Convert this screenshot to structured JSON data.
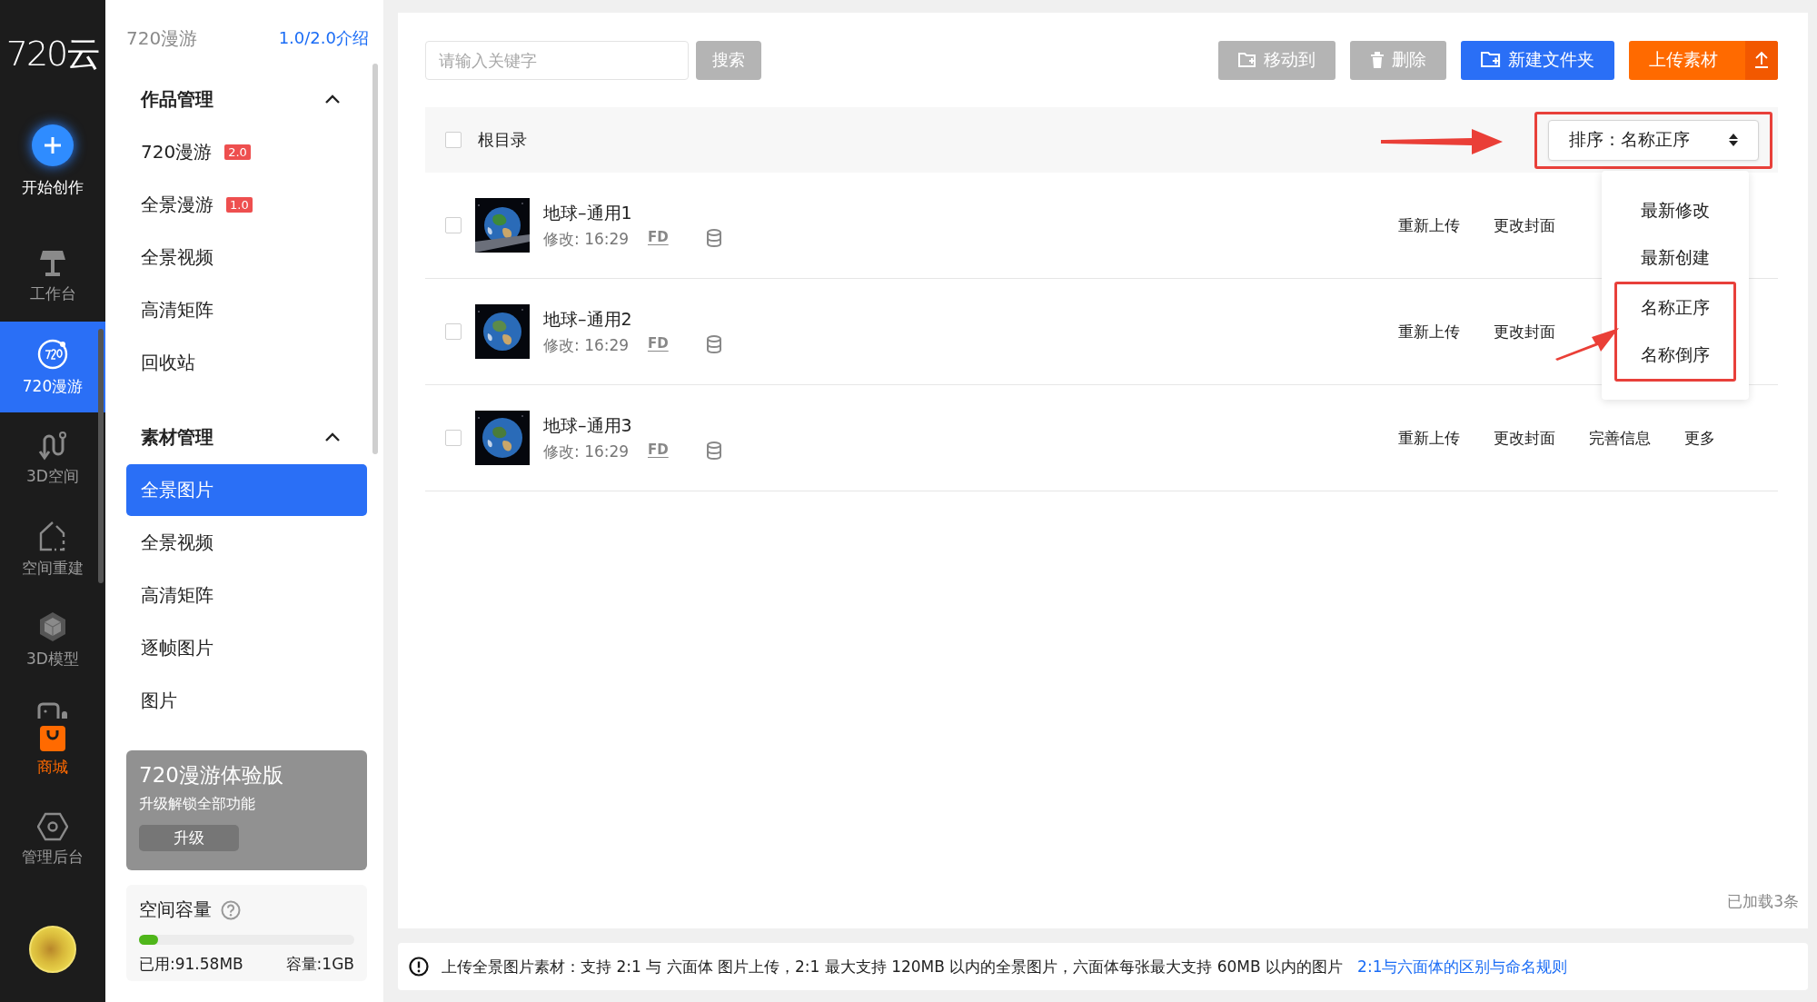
{
  "nav": {
    "logo": "720云",
    "create": {
      "label": "开始创作"
    },
    "items": [
      {
        "kind": "workbench",
        "label": "工作台",
        "selected": false,
        "accent": false
      },
      {
        "kind": "tour",
        "label": "720漫游",
        "selected": true,
        "accent": false
      },
      {
        "kind": "space3d",
        "label": "3D空间",
        "selected": false,
        "accent": false
      },
      {
        "kind": "rebuild",
        "label": "空间重建",
        "selected": false,
        "accent": false
      },
      {
        "kind": "model",
        "label": "3D模型",
        "selected": false,
        "accent": false
      },
      {
        "kind": "shop",
        "label": "商城",
        "selected": false,
        "accent": true
      },
      {
        "kind": "admin",
        "label": "管理后台",
        "selected": false,
        "accent": false
      }
    ]
  },
  "sidebar": {
    "title": "720漫游",
    "intro_link": "1.0/2.0介绍",
    "sections": [
      {
        "title": "作品管理",
        "expanded": true,
        "items": [
          {
            "label": "720漫游",
            "badge": "2.0",
            "selected": false
          },
          {
            "label": "全景漫游",
            "badge": "1.0",
            "selected": false
          },
          {
            "label": "全景视频",
            "selected": false
          },
          {
            "label": "高清矩阵",
            "selected": false
          },
          {
            "label": "回收站",
            "selected": false
          }
        ]
      },
      {
        "title": "素材管理",
        "expanded": true,
        "items": [
          {
            "label": "全景图片",
            "selected": true
          },
          {
            "label": "全景视频",
            "selected": false
          },
          {
            "label": "高清矩阵",
            "selected": false
          },
          {
            "label": "逐帧图片",
            "selected": false
          },
          {
            "label": "图片",
            "selected": false
          }
        ]
      }
    ],
    "promo": {
      "title": "720漫游体验版",
      "subtitle": "升级解锁全部功能",
      "button": "升级"
    },
    "storage": {
      "title": "空间容量",
      "level": 0.09,
      "used": "已用:91.58MB",
      "capacity": "容量:1GB"
    }
  },
  "toolbar": {
    "search": {
      "placeholder": "请输入关键字",
      "button": "搜索"
    },
    "buttons": [
      {
        "kind": "move",
        "label": "移动到",
        "disabled": true
      },
      {
        "kind": "delete",
        "label": "删除",
        "disabled": true
      },
      {
        "kind": "new-folder",
        "label": "新建文件夹",
        "disabled": false
      },
      {
        "kind": "upload",
        "label": "上传素材",
        "disabled": false
      }
    ]
  },
  "list": {
    "header": {
      "label": "根目录",
      "checked": false
    },
    "sort": {
      "label": "排序：名称正序",
      "expanded": true,
      "highlighted": true,
      "options": [
        {
          "label": "最新修改",
          "highlighted": false
        },
        {
          "label": "最新创建",
          "highlighted": false
        },
        {
          "label": "名称正序",
          "highlighted": true
        },
        {
          "label": "名称倒序",
          "highlighted": true
        }
      ]
    },
    "rows": [
      {
        "name": "地球–通用1",
        "modified": "修改: 16:29",
        "tag": "FD",
        "checked": false,
        "actions": [
          "重新上传",
          "更改封面"
        ]
      },
      {
        "name": "地球–通用2",
        "modified": "修改: 16:29",
        "tag": "FD",
        "checked": false,
        "actions": [
          "重新上传",
          "更改封面"
        ]
      },
      {
        "name": "地球–通用3",
        "modified": "修改: 16:29",
        "tag": "FD",
        "checked": false,
        "actions": [
          "重新上传",
          "更改封面",
          "完善信息",
          "更多"
        ]
      }
    ],
    "footer": "已加载3条"
  },
  "notice": {
    "text": "上传全景图片素材：支持 2:1 与 六面体 图片上传，2:1 最大支持 120MB 以内的全景图片，六面体每张最大支持 60MB 以内的图片",
    "link": "2:1与六面体的区别与命名规则"
  }
}
